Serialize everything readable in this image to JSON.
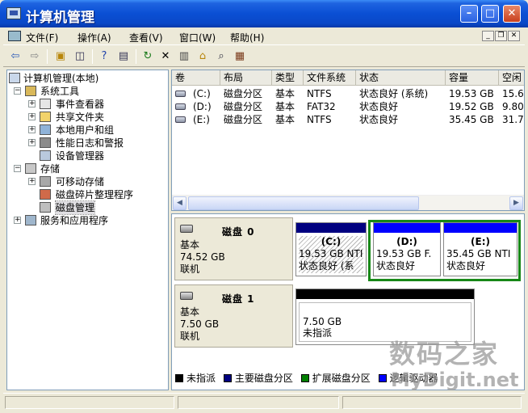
{
  "window": {
    "title": "计算机管理"
  },
  "menu": [
    "文件(F)",
    "操作(A)",
    "查看(V)",
    "窗口(W)",
    "帮助(H)"
  ],
  "toolbar_icons": [
    "back-arrow-icon",
    "forward-arrow-icon",
    "up-folder-icon",
    "show-tree-icon",
    "help-icon",
    "export-list-icon",
    "refresh-icon",
    "delete-icon",
    "properties-icon",
    "open-icon",
    "search-icon",
    "wizard-icon"
  ],
  "tree": {
    "root": "计算机管理(本地)",
    "items": [
      "系统工具",
      "事件查看器",
      "共享文件夹",
      "本地用户和组",
      "性能日志和警报",
      "设备管理器",
      "存储",
      "可移动存储",
      "磁盘碎片整理程序",
      "磁盘管理",
      "服务和应用程序"
    ]
  },
  "volumes": {
    "columns": [
      "卷",
      "布局",
      "类型",
      "文件系统",
      "状态",
      "容量",
      "空闲"
    ],
    "rows": [
      [
        "(C:)",
        "磁盘分区",
        "基本",
        "NTFS",
        "状态良好 (系统)",
        "19.53 GB",
        "15.6"
      ],
      [
        "(D:)",
        "磁盘分区",
        "基本",
        "FAT32",
        "状态良好",
        "19.52 GB",
        "9.80"
      ],
      [
        "(E:)",
        "磁盘分区",
        "基本",
        "NTFS",
        "状态良好",
        "35.45 GB",
        "31.7"
      ]
    ]
  },
  "disks": [
    {
      "title": "磁盘 0",
      "type": "基本",
      "size": "74.52 GB",
      "status": "联机",
      "partitions": [
        {
          "name": "(C:)",
          "size": "19.53 GB NTI",
          "status": "状态良好 (系"
        },
        {
          "name": "(D:)",
          "size": "19.53 GB F.",
          "status": "状态良好"
        },
        {
          "name": "(E:)",
          "size": "35.45 GB NTI",
          "status": "状态良好"
        }
      ]
    },
    {
      "title": "磁盘 1",
      "type": "基本",
      "size": "7.50 GB",
      "status": "联机",
      "partitions": [
        {
          "size": "7.50 GB",
          "status": "未指派"
        }
      ]
    }
  ],
  "legend": [
    {
      "label": "未指派",
      "color": "#000000"
    },
    {
      "label": "主要磁盘分区",
      "color": "#000080"
    },
    {
      "label": "扩展磁盘分区",
      "color": "#008000"
    },
    {
      "label": "逻辑驱动器",
      "color": "#0000FF"
    }
  ],
  "colors": {
    "primary": "#000080",
    "logical": "#0000FF",
    "extended": "#188818",
    "unallocated": "#000000"
  },
  "watermark": {
    "line1": "数码之家",
    "line2": "MyDigit.net"
  }
}
